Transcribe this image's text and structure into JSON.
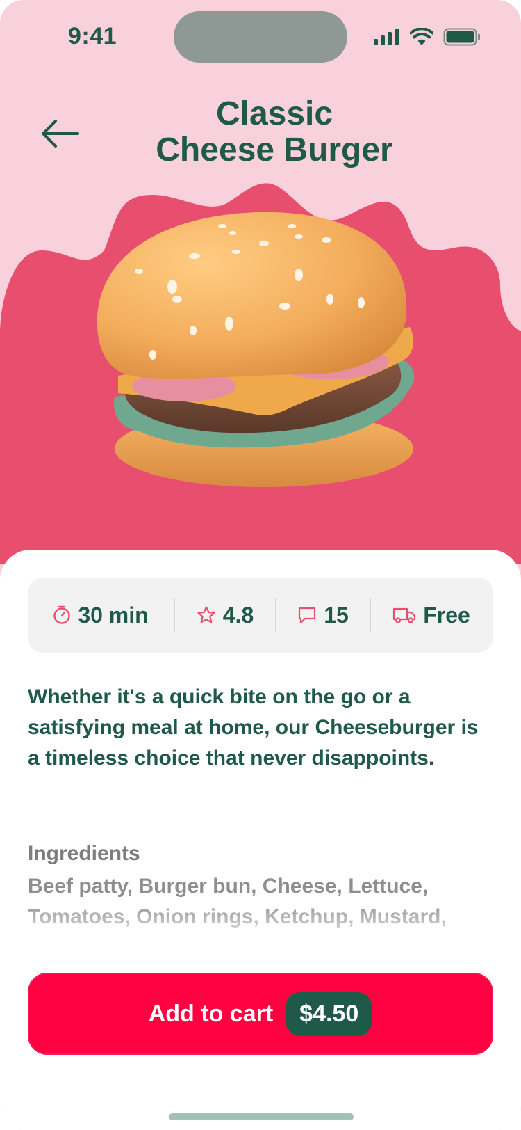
{
  "status_bar": {
    "time": "9:41"
  },
  "header": {
    "title_line1": "Classic",
    "title_line2": "Cheese Burger"
  },
  "colors": {
    "brand": "#1f5a48",
    "accent": "#ff0040",
    "hero_bg": "#e84e6e",
    "page_bg": "#f9d1dc"
  },
  "stats": [
    {
      "icon": "timer-icon",
      "value": "30 min"
    },
    {
      "icon": "star-icon",
      "value": "4.8"
    },
    {
      "icon": "comment-icon",
      "value": "15"
    },
    {
      "icon": "truck-icon",
      "value": "Free"
    }
  ],
  "description": "Whether it's a quick bite on the go or a satisfying meal at home, our Cheeseburger is a timeless choice that never disappoints.",
  "ingredients": {
    "title": "Ingredients",
    "list": "Beef patty, Burger bun, Cheese, Lettuce, Tomatoes, Onion rings, Ketchup, Mustard,"
  },
  "cart": {
    "label": "Add to cart",
    "price": "$4.50"
  }
}
